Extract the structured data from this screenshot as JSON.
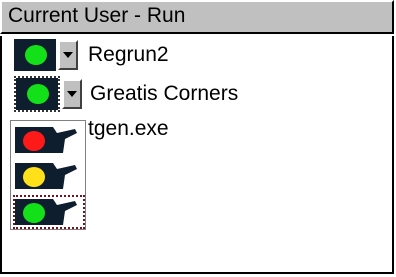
{
  "panel": {
    "title": "Current User - Run"
  },
  "entries": [
    {
      "label": "Regrun2",
      "status": "green"
    },
    {
      "label": "Greatis Corners",
      "status": "green"
    },
    {
      "label": "tgen.exe",
      "status": "green"
    }
  ],
  "status_menu": {
    "options": [
      {
        "name": "red",
        "color": "#ff1a1a"
      },
      {
        "name": "yellow",
        "color": "#ffe01a"
      },
      {
        "name": "green",
        "color": "#14e01a"
      }
    ],
    "selected": "green"
  },
  "colors": {
    "header_bg": "#c0c0c0",
    "light_housing": "#0f1e2e",
    "green": "#14e01a"
  }
}
